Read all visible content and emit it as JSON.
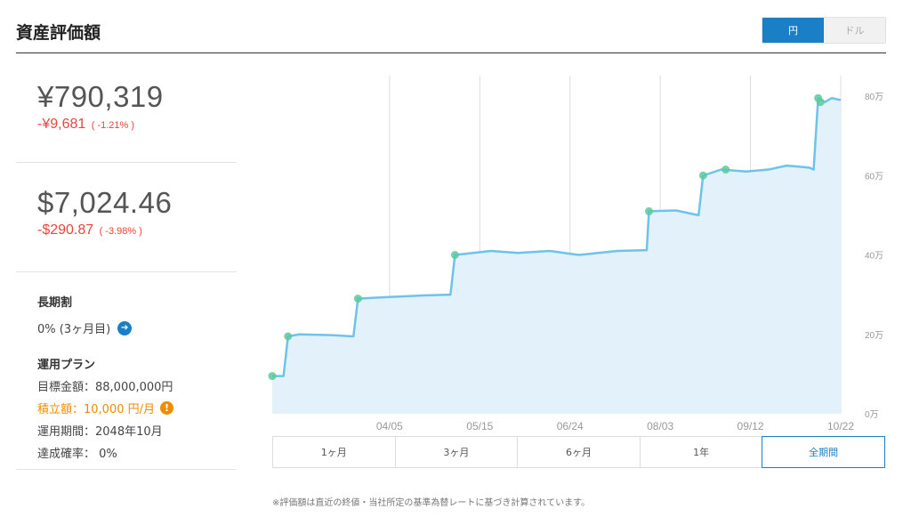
{
  "header": {
    "title": "資産評価額",
    "currency_options": [
      "円",
      "ドル"
    ],
    "selected_currency": "円"
  },
  "summary": {
    "jpy": {
      "value": "¥790,319",
      "change": "-¥9,681",
      "change_pct": "( -1.21% )"
    },
    "usd": {
      "value": "$7,024.46",
      "change": "-$290.87",
      "change_pct": "( -3.98% )"
    }
  },
  "long_term": {
    "heading": "長期割",
    "value": "0% (3ヶ月目)"
  },
  "plan": {
    "heading": "運用プラン",
    "target": "目標金額：88,000,000円",
    "monthly": "積立額：10,000 円/月",
    "period": "運用期間：2048年10月",
    "achievement": "達成確率： 0%"
  },
  "period_tabs": [
    "1ヶ月",
    "3ヶ月",
    "6ヶ月",
    "1年",
    "全期間"
  ],
  "selected_period": "全期間",
  "footnote": "※評価額は直近の終値・当社所定の基準為替レートに基づき計算されています。",
  "colors": {
    "accent": "#1a7fc6",
    "negative": "#e8453c",
    "warning": "#f08c00",
    "line": "#6ec3ea",
    "area": "#e3f1fa",
    "marker": "#5cc9a0"
  },
  "chart_data": {
    "type": "area",
    "x_start": "02/13",
    "x_end": "10/22",
    "tick_labels": [
      "04/05",
      "05/15",
      "06/24",
      "08/03",
      "09/12",
      "10/22"
    ],
    "y_tick_labels": [
      "0万",
      "20万",
      "40万",
      "60万",
      "80万"
    ],
    "y_unit": "万円",
    "ylim": [
      0,
      80
    ],
    "grid": "vertical",
    "series": [
      {
        "points": [
          [
            "02/13",
            9.5
          ],
          [
            "02/18",
            9.5
          ],
          [
            "02/20",
            19.5
          ],
          [
            "02/25",
            20.0
          ],
          [
            "03/10",
            19.8
          ],
          [
            "03/20",
            19.5
          ],
          [
            "03/22",
            29.0
          ],
          [
            "04/01",
            29.3
          ],
          [
            "04/20",
            29.8
          ],
          [
            "05/02",
            30.0
          ],
          [
            "05/04",
            40.0
          ],
          [
            "05/20",
            41.0
          ],
          [
            "06/01",
            40.5
          ],
          [
            "06/15",
            41.0
          ],
          [
            "06/28",
            40.0
          ],
          [
            "07/15",
            41.0
          ],
          [
            "07/28",
            41.2
          ],
          [
            "07/29",
            51.0
          ],
          [
            "08/10",
            51.2
          ],
          [
            "08/20",
            50.0
          ],
          [
            "08/22",
            60.0
          ],
          [
            "08/30",
            61.5
          ],
          [
            "09/10",
            61.0
          ],
          [
            "09/20",
            61.5
          ],
          [
            "09/28",
            62.5
          ],
          [
            "10/08",
            62.0
          ],
          [
            "10/10",
            61.5
          ],
          [
            "10/12",
            79.5
          ],
          [
            "10/15",
            78.5
          ],
          [
            "10/18",
            79.5
          ],
          [
            "10/22",
            79.0
          ]
        ]
      }
    ],
    "deposit_markers": [
      [
        "02/13",
        9.5
      ],
      [
        "02/20",
        19.5
      ],
      [
        "03/22",
        29.0
      ],
      [
        "05/04",
        40.0
      ],
      [
        "07/29",
        51.0
      ],
      [
        "08/22",
        60.0
      ],
      [
        "09/01",
        61.5
      ],
      [
        "10/12",
        79.5
      ],
      [
        "10/13",
        78.5
      ]
    ]
  }
}
